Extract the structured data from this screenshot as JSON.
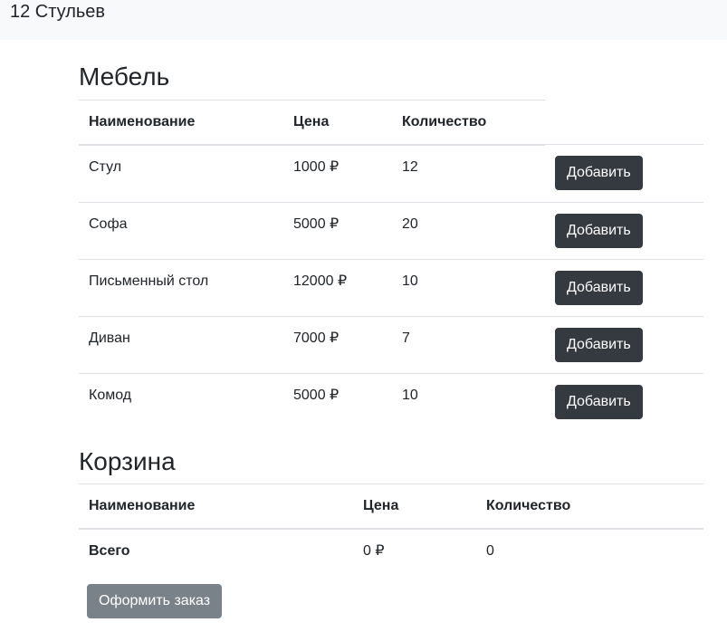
{
  "navbar": {
    "brand": "12 Стульев"
  },
  "furniture": {
    "title": "Мебель",
    "columns": [
      "Наименование",
      "Цена",
      "Количество"
    ],
    "add_label": "Добавить",
    "rows": [
      {
        "name": "Стул",
        "price": "1000 ₽",
        "qty": "12"
      },
      {
        "name": "Софа",
        "price": "5000 ₽",
        "qty": "20"
      },
      {
        "name": "Письменный стол",
        "price": "12000 ₽",
        "qty": "10"
      },
      {
        "name": "Диван",
        "price": "7000 ₽",
        "qty": "7"
      },
      {
        "name": "Комод",
        "price": "5000 ₽",
        "qty": "10"
      }
    ]
  },
  "cart": {
    "title": "Корзина",
    "columns": [
      "Наименование",
      "Цена",
      "Количество"
    ],
    "total_label": "Всего",
    "total_price": "0 ₽",
    "total_qty": "0",
    "order_label": "Оформить заказ"
  },
  "colors": {
    "navbar_bg": "#f8f9fa",
    "dark_button": "#343a40",
    "secondary_button": "#6c757d",
    "border": "#dee2e6"
  }
}
